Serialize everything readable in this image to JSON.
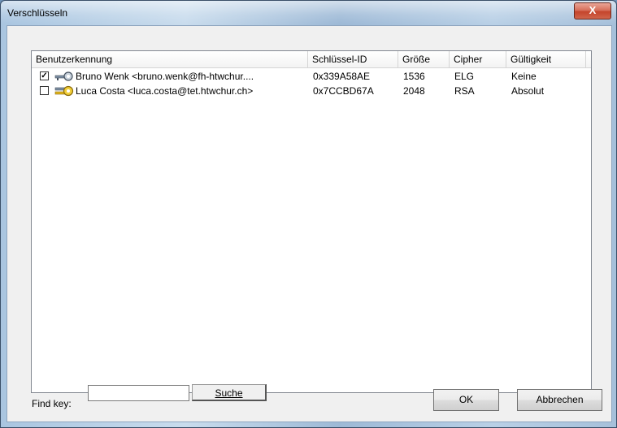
{
  "window": {
    "title": "Verschlüsseln",
    "close_label": "X"
  },
  "columns": [
    "Benutzerkennung",
    "Schlüssel-ID",
    "Größe",
    "Cipher",
    "Gültigkeit"
  ],
  "rows": [
    {
      "checked": true,
      "icon": "key-icon",
      "user": "Bruno Wenk <bruno.wenk@fh-htwchur....",
      "key_id": "0x339A58AE",
      "size": "1536",
      "cipher": "ELG",
      "validity": "Keine"
    },
    {
      "checked": false,
      "icon": "key-pair-icon",
      "user": "Luca Costa <luca.costa@tet.htwchur.ch>",
      "key_id": "0x7CCBD67A",
      "size": "2048",
      "cipher": "RSA",
      "validity": "Absolut"
    }
  ],
  "footer": {
    "find_label": "Find key:",
    "find_value": "",
    "search_label": "Suche",
    "ok_label": "OK",
    "cancel_label": "Abbrechen"
  },
  "colors": {
    "icon_key": "#7d8fa3",
    "icon_key_pair": "#e1b41a"
  }
}
